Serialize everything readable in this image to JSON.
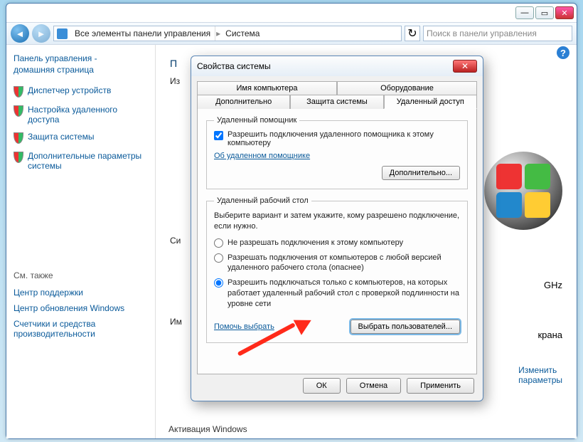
{
  "titlebar": {
    "min": "—",
    "max": "▭",
    "close": "✕"
  },
  "breadcrumb": {
    "root": "Все элементы панели управления",
    "leaf": "Система",
    "sep": "▸"
  },
  "search": {
    "placeholder": "Поиск в панели управления"
  },
  "sidebar": {
    "home_l1": "Панель управления -",
    "home_l2": "домашняя страница",
    "items": [
      "Диспетчер устройств",
      "Настройка удаленного доступа",
      "Защита системы",
      "Дополнительные параметры системы"
    ],
    "seealso_title": "См. также",
    "seealso": [
      "Центр поддержки",
      "Центр обновления Windows",
      "Счетчики и средства производительности"
    ]
  },
  "main": {
    "heading_trunc": "П",
    "sub_trunc": "Из",
    "ci": "Си",
    "im": "Им",
    "ghz": "GHz",
    "krana": "крана",
    "change": "Изменить",
    "params": "параметры",
    "activation": "Активация Windows"
  },
  "dialog": {
    "title": "Свойства системы",
    "tabs_row1": [
      "Имя компьютера",
      "Оборудование"
    ],
    "tabs_row2": [
      "Дополнительно",
      "Защита системы",
      "Удаленный доступ"
    ],
    "group1": {
      "legend": "Удаленный помощник",
      "checkbox": "Разрешить подключения удаленного помощника к этому компьютеру",
      "link": "Об удаленном помощнике",
      "btn": "Дополнительно..."
    },
    "group2": {
      "legend": "Удаленный рабочий стол",
      "desc": "Выберите вариант и затем укажите, кому разрешено подключение, если нужно.",
      "r1": "Не разрешать подключения к этому компьютеру",
      "r2": "Разрешать подключения от компьютеров с любой версией удаленного рабочего стола (опаснее)",
      "r3": "Разрешить подключаться только с компьютеров, на которых работает удаленный рабочий стол с проверкой подлинности на уровне сети",
      "help": "Помочь выбрать",
      "select_users": "Выбрать пользователей..."
    },
    "buttons": {
      "ok": "ОК",
      "cancel": "Отмена",
      "apply": "Применить"
    }
  }
}
